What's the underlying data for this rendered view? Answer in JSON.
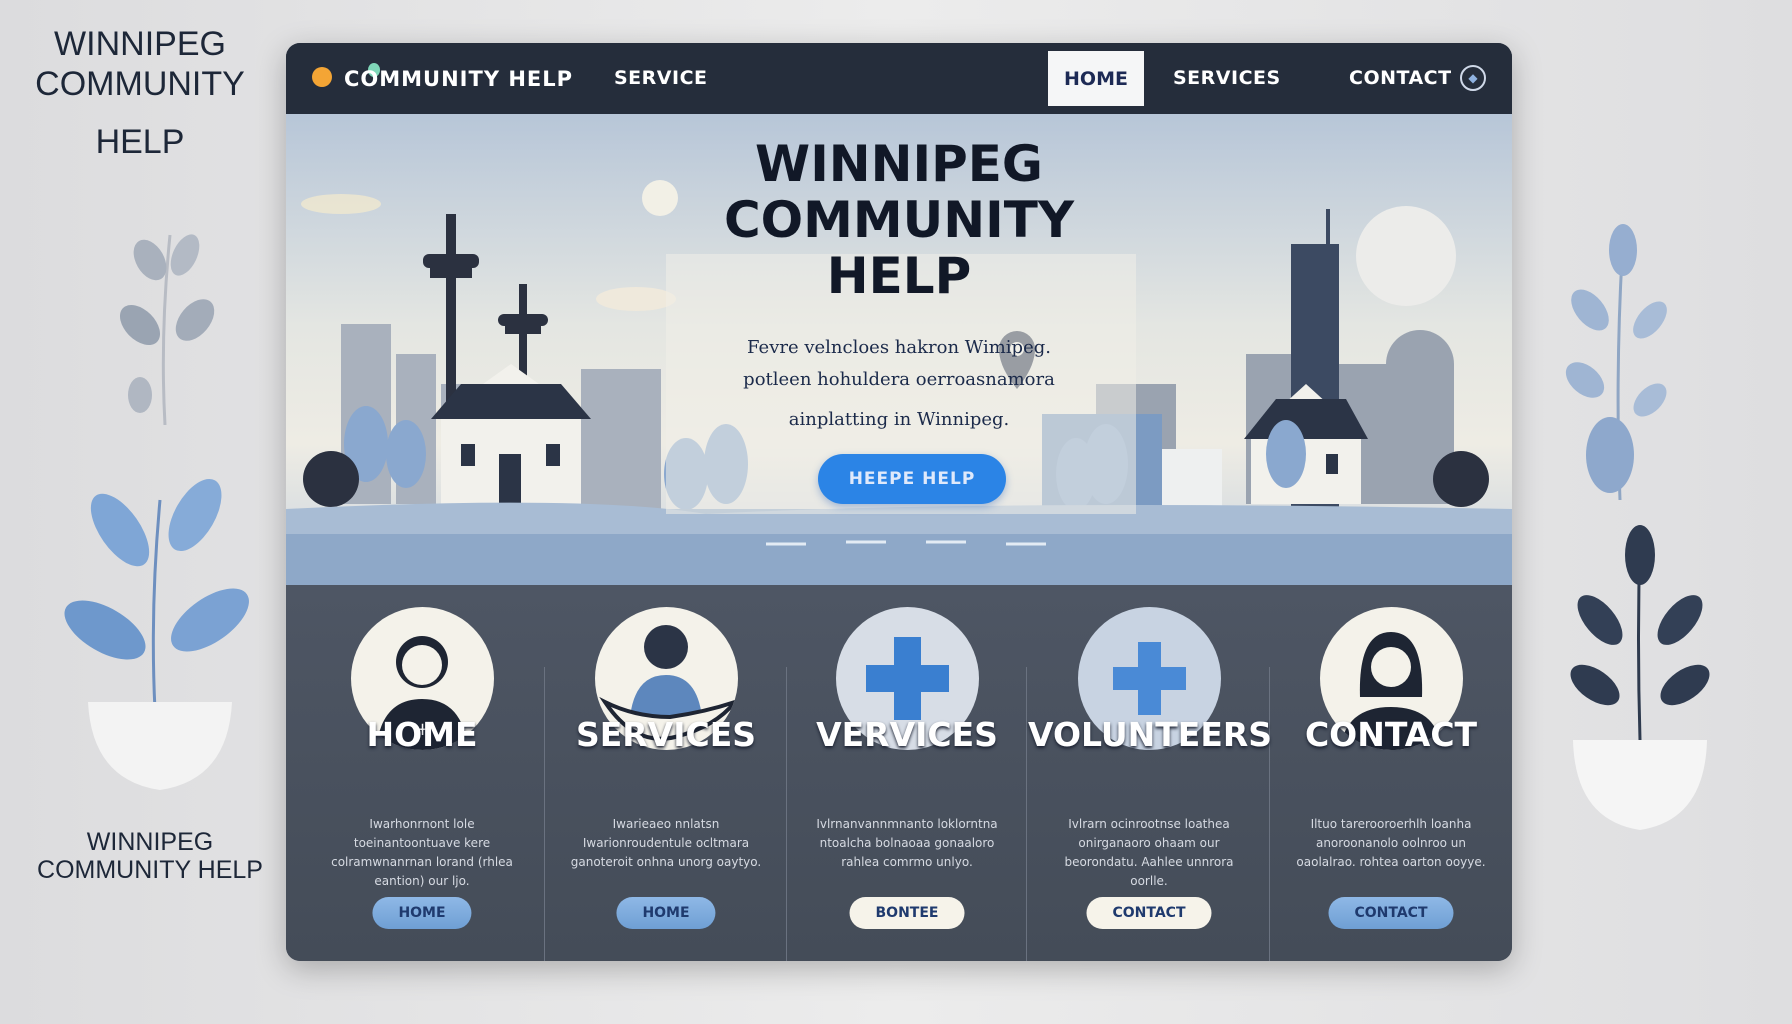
{
  "side": {
    "title_line1": "WINNIPEG",
    "title_line2": "COMMUNITY",
    "title_line3": "HELP",
    "bottom_line1": "WINNIPEG",
    "bottom_line2": "COMMUNITY HELP"
  },
  "header": {
    "brand": "COMMUNITY HELP",
    "service": "SERVICE",
    "nav": [
      "HOME",
      "SERVICES",
      "CONTACT"
    ],
    "active": "HOME"
  },
  "hero": {
    "title_lines": [
      "WINNIPEG",
      "COMMUNITY",
      "HELP"
    ],
    "text_lines": [
      "Fevre velncloes hakron Wimipeg.",
      "potleen hohuldera oerroasnamora",
      "ainplatting in Winnipeg."
    ],
    "button": "HEEPE HELP"
  },
  "cards": [
    {
      "title": "HOME",
      "text": "Iwarhonrnont lole toeinantoontuave kere colramwnanrnan lorand (rhlea eantion) our ljo.",
      "button": "HOME",
      "icon": "person-icon"
    },
    {
      "title": "SERVICES",
      "text": "Iwarieaeo nnlatsn Iwarionroudentule ocltmara ganoteroit onhna unorg oaytyo.",
      "button": "HOME",
      "icon": "helping-hand-icon"
    },
    {
      "title": "VERVICES",
      "text": "Ivlrnanvannmnanto loklorntna ntoalcha bolnaoaa gonaaloro rahlea comrmo unlyo.",
      "button": "BONTEE",
      "icon": "medical-cross-icon"
    },
    {
      "title": "VOLUNTEERS",
      "text": "Ivlrarn ocinrootnse loathea onirganaoro ohaam our beorondatu. Aahlee unnrora oorlle.",
      "button": "CONTACT",
      "icon": "plus-icon"
    },
    {
      "title": "CONTACT",
      "text": "Iltuo tarerooroerhlh loanha anoroonanolo oolnroo un oaolalrao. rohtea oarton ooyye.",
      "button": "CONTACT",
      "icon": "woman-icon"
    }
  ],
  "colors": {
    "header": "#252d3b",
    "accent": "#2b84e6",
    "cards_bg": "#4a5260"
  }
}
